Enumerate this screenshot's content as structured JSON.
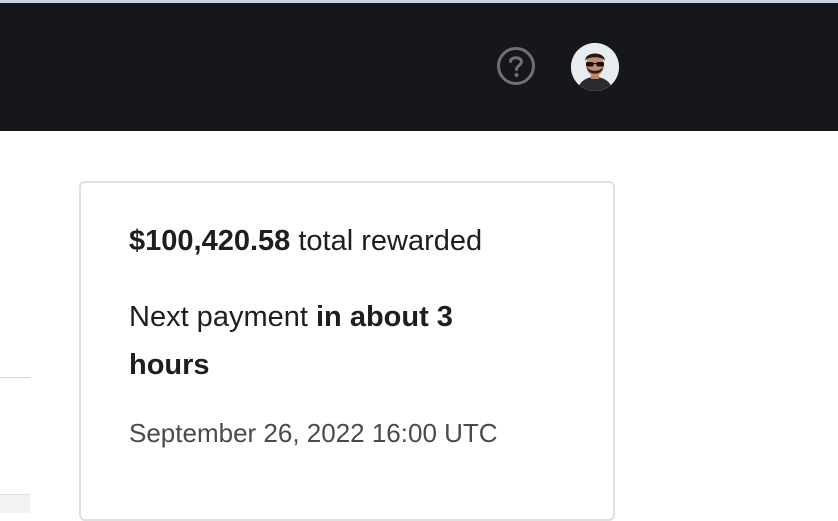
{
  "header": {
    "help_icon": "question-circle-icon",
    "avatar_icon": "user-avatar"
  },
  "rewards_card": {
    "total_amount": "$100,420.58",
    "total_suffix": " total rewarded",
    "next_prefix": "Next payment ",
    "next_when": "in about 3 hours",
    "next_date": "September 26, 2022 16:00 UTC"
  },
  "colors": {
    "topbar_bg": "#16171b",
    "text_primary": "#1e1e20",
    "text_secondary": "#4a4a4e",
    "card_border": "#e0e0e0"
  }
}
